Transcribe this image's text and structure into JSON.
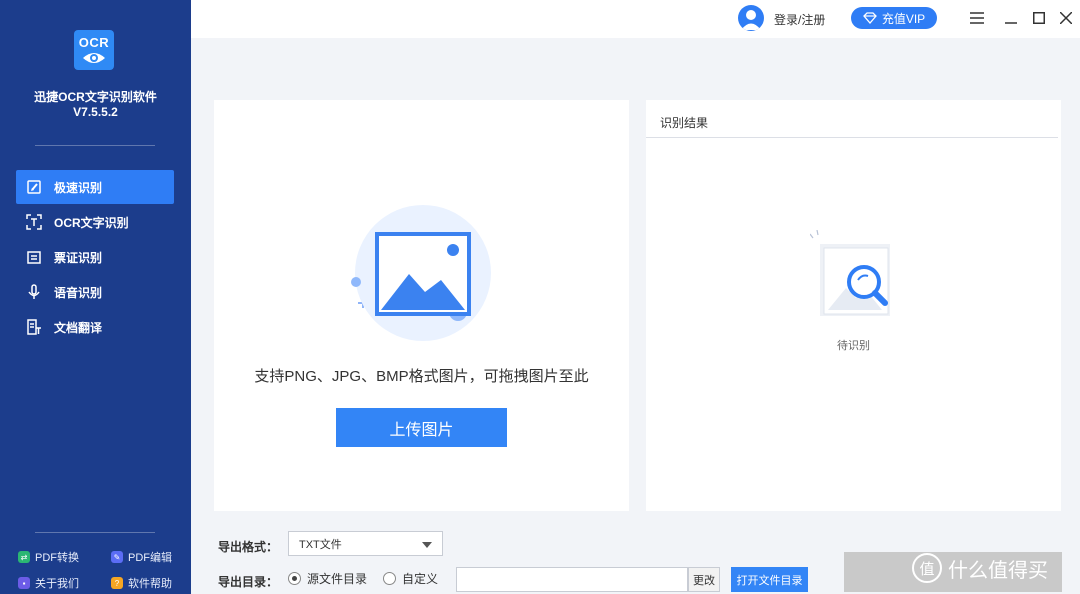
{
  "app": {
    "logo_text": "OCR",
    "name": "迅捷OCR文字识别软件",
    "version": "V7.5.5.2"
  },
  "sidebar": {
    "items": [
      {
        "label": "极速识别",
        "icon": "fast-recognize-icon",
        "active": true
      },
      {
        "label": "OCR文字识别",
        "icon": "scan-frame-icon",
        "active": false
      },
      {
        "label": "票证识别",
        "icon": "ticket-icon",
        "active": false
      },
      {
        "label": "语音识别",
        "icon": "microphone-icon",
        "active": false
      },
      {
        "label": "文档翻译",
        "icon": "document-translate-icon",
        "active": false
      }
    ],
    "footer_links": [
      {
        "label": "PDF转换",
        "icon": "pdf-convert-icon",
        "color": "#2bb673"
      },
      {
        "label": "PDF编辑",
        "icon": "pdf-edit-icon",
        "color": "#5b6df5"
      },
      {
        "label": "关于我们",
        "icon": "about-icon",
        "color": "#6c5ce7"
      },
      {
        "label": "软件帮助",
        "icon": "help-icon",
        "color": "#f5a623"
      }
    ]
  },
  "topbar": {
    "login_label": "登录/注册",
    "vip_label": "充值VIP"
  },
  "upload_panel": {
    "hint": "支持PNG、JPG、BMP格式图片，可拖拽图片至此",
    "upload_button": "上传图片"
  },
  "result_panel": {
    "title": "识别结果",
    "status": "待识别"
  },
  "export": {
    "format_label": "导出格式：",
    "format_value": "TXT文件",
    "dir_label": "导出目录：",
    "option_source": "源文件目录",
    "option_custom": "自定义",
    "path_value": "",
    "change_label": "更改",
    "open_dir_label": "打开文件目录"
  },
  "watermark": {
    "badge": "值",
    "text": "什么值得买"
  },
  "colors": {
    "sidebar_bg": "#1c3d8c",
    "accent": "#2f7df5",
    "page_bg": "#f2f4f8"
  }
}
